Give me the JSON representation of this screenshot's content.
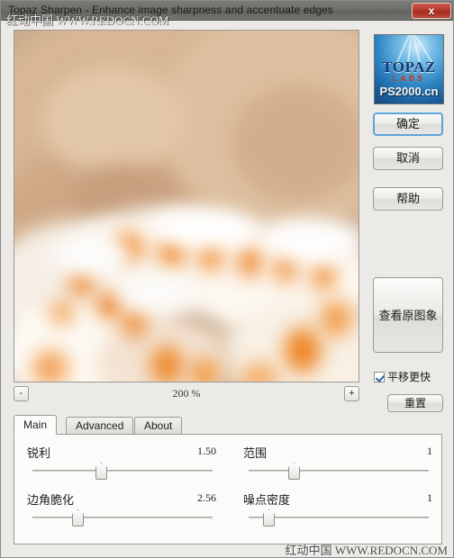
{
  "window": {
    "title": "Topaz Sharpen - Enhance image sharpness and accentuate edges",
    "close_label": "x"
  },
  "watermarks": {
    "top": "红动中国 WWW.REDOCN.COM",
    "bottom": "红动中国 WWW.REDOCN.COM",
    "logo": "PS2000.cn"
  },
  "preview": {
    "subject": "blurred seashell on sand",
    "zoom_level": "200 %",
    "zoom_out_label": "-",
    "zoom_in_label": "+"
  },
  "tabs": [
    {
      "label": "Main",
      "active": true
    },
    {
      "label": "Advanced",
      "active": false
    },
    {
      "label": "About",
      "active": false
    }
  ],
  "sliders": [
    {
      "label": "锐利",
      "value": "1.50",
      "percent": 35
    },
    {
      "label": "范围",
      "value": "1",
      "percent": 22
    },
    {
      "label": "边角脆化",
      "value": "2.56",
      "percent": 22
    },
    {
      "label": "噪点密度",
      "value": "1",
      "percent": 8
    }
  ],
  "logo": {
    "brand": "TOPAZ",
    "sub": "LABS"
  },
  "buttons": {
    "ok": "确定",
    "cancel": "取消",
    "help": "帮助",
    "view_original": "查看原图象",
    "reset": "重置"
  },
  "checkbox": {
    "label": "平移更快",
    "checked": true
  },
  "colors": {
    "accent": "#5ba6d8",
    "close_red": "#b63b2d",
    "logo_blue": "#2f86c4",
    "logo_red": "#c23a22",
    "panel_bg": "#fcfbf9",
    "window_bg": "#eceae6"
  }
}
